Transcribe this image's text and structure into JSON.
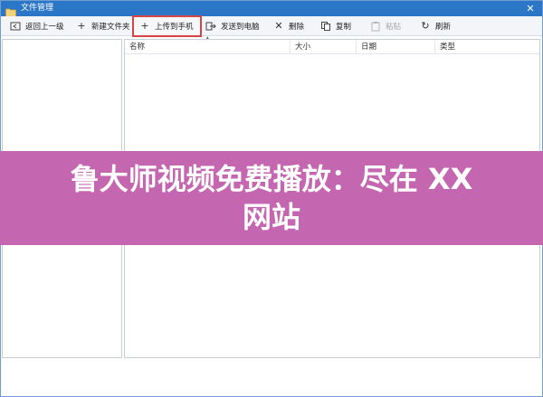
{
  "window": {
    "title": "文件管理",
    "close_glyph": "✕"
  },
  "toolbar": {
    "back": {
      "label": "返回上一级",
      "icon": "back-arrow-icon"
    },
    "new_folder": {
      "label": "新建文件夹",
      "icon": "plus-icon"
    },
    "upload": {
      "label": "上传到手机",
      "icon": "plus-icon",
      "highlighted": true
    },
    "send": {
      "label": "发送到电脑",
      "icon": "export-icon"
    },
    "delete": {
      "label": "删除",
      "icon": "x-icon"
    },
    "copy": {
      "label": "复制",
      "icon": "copy-icon"
    },
    "paste": {
      "label": "粘贴",
      "icon": "paste-icon",
      "disabled": true
    },
    "refresh": {
      "label": "刷新",
      "icon": "refresh-icon"
    }
  },
  "file_list": {
    "columns": [
      "名称",
      "大小",
      "日期",
      "类型"
    ],
    "rows": []
  },
  "banner": {
    "line1": "鲁大师视频免费播放：尽在 XX",
    "line2": "网站",
    "background": "#c566b1"
  },
  "colors": {
    "titlebar": "#2b76c6",
    "highlight_border": "#d64545"
  }
}
